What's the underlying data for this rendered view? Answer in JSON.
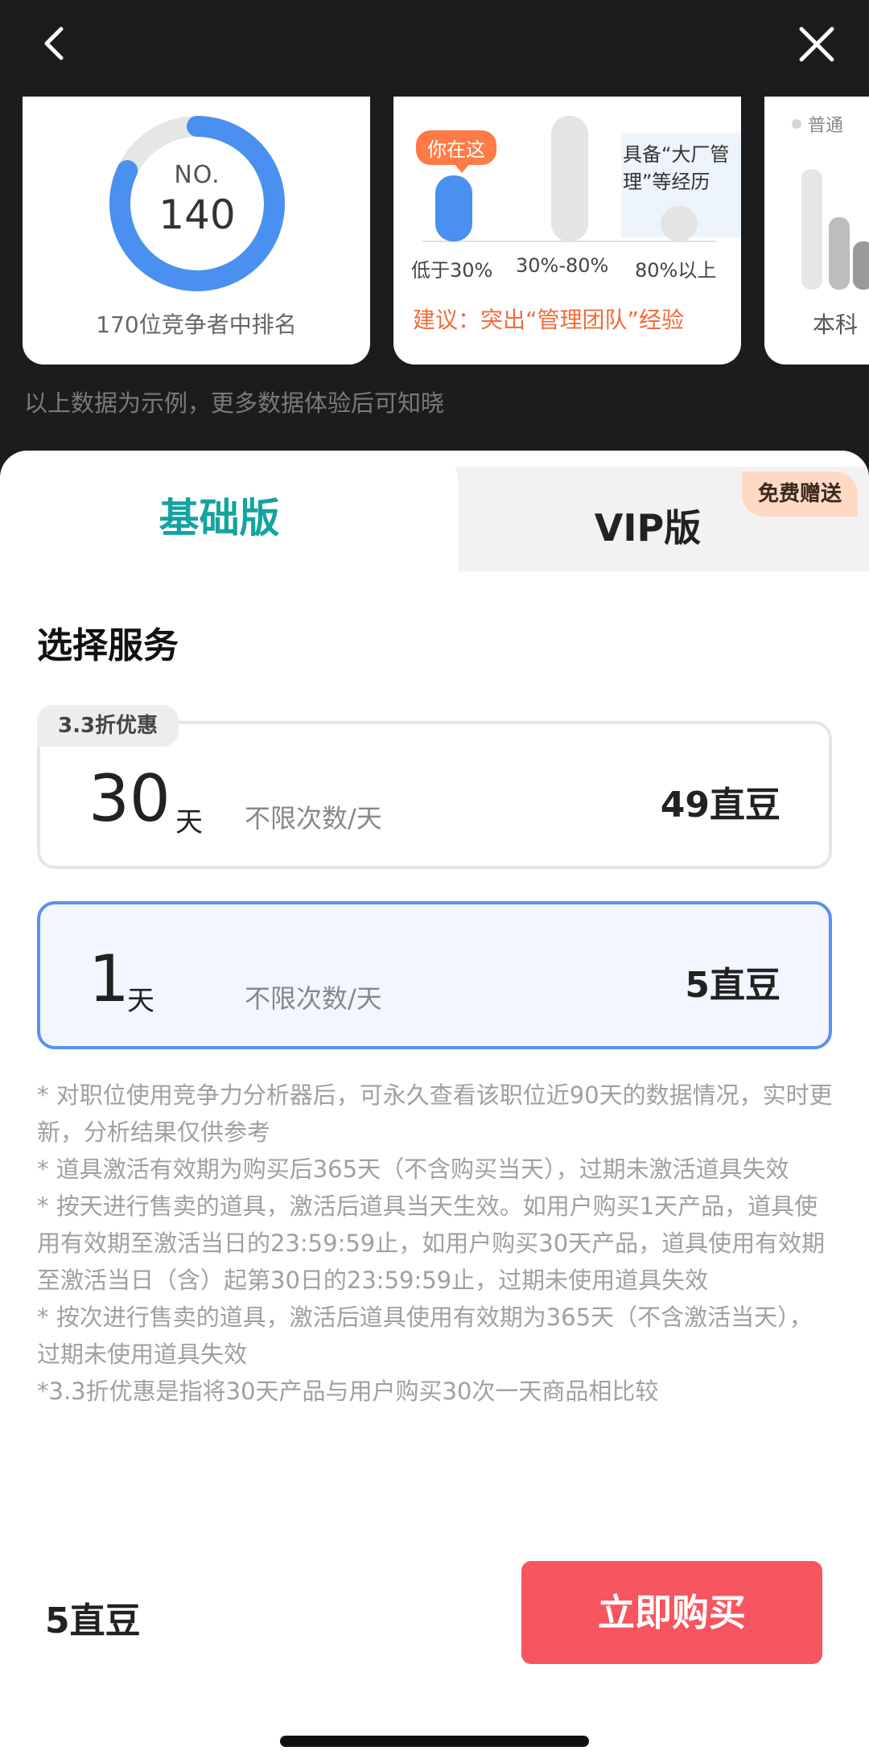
{
  "nav": {
    "back_icon": "chevron-left-icon",
    "close_icon": "close-icon"
  },
  "cards": {
    "rank": {
      "no_label": "NO.",
      "rank_value": "140",
      "caption": "170位竞争者中排名",
      "ring_fraction": 0.82
    },
    "experience": {
      "bubble": "你在这",
      "hint": "具备“大厂管理”等经历",
      "axis_labels": [
        "低于30%",
        "30%-80%",
        "80%以上"
      ],
      "tip": "建议：突出“管理团队”经验"
    },
    "education": {
      "legend": "普通",
      "label": "本科"
    }
  },
  "note_top": "以上数据为示例，更多数据体验后可知晓",
  "tabs": {
    "basic": "基础版",
    "vip": "VIP版",
    "vip_badge": "免费赠送"
  },
  "section_title": "选择服务",
  "plans": [
    {
      "tag": "3.3折优惠",
      "days": "30",
      "unit": "天",
      "desc": "不限次数/天",
      "price": "49直豆",
      "selected": false
    },
    {
      "days": "1",
      "unit": "天",
      "desc": "不限次数/天",
      "price": "5直豆",
      "selected": true
    }
  ],
  "notes": [
    "* 对职位使用竞争力分析器后，可永久查看该职位近90天的数据情况，实时更新，分析结果仅供参考",
    "* 道具激活有效期为购买后365天（不含购买当天），过期未激活道具失效",
    "* 按天进行售卖的道具，激活后道具当天生效。如用户购买1天产品，道具使用有效期至激活当日的23:59:59止，如用户购买30天产品，道具使用有效期至激活当日（含）起第30日的23:59:59止，过期未使用道具失效",
    "* 按次进行售卖的道具，激活后道具使用有效期为365天（不含激活当天），过期未使用道具失效",
    "*3.3折优惠是指将30天产品与用户购买30次一天商品相比较"
  ],
  "footer": {
    "price": "5直豆",
    "buy_label": "立即购买"
  },
  "colors": {
    "accent_teal": "#14a3a0",
    "buy_red": "#f7555f",
    "select_blue": "#5b8ff0",
    "tip_orange": "#f26b3a"
  }
}
